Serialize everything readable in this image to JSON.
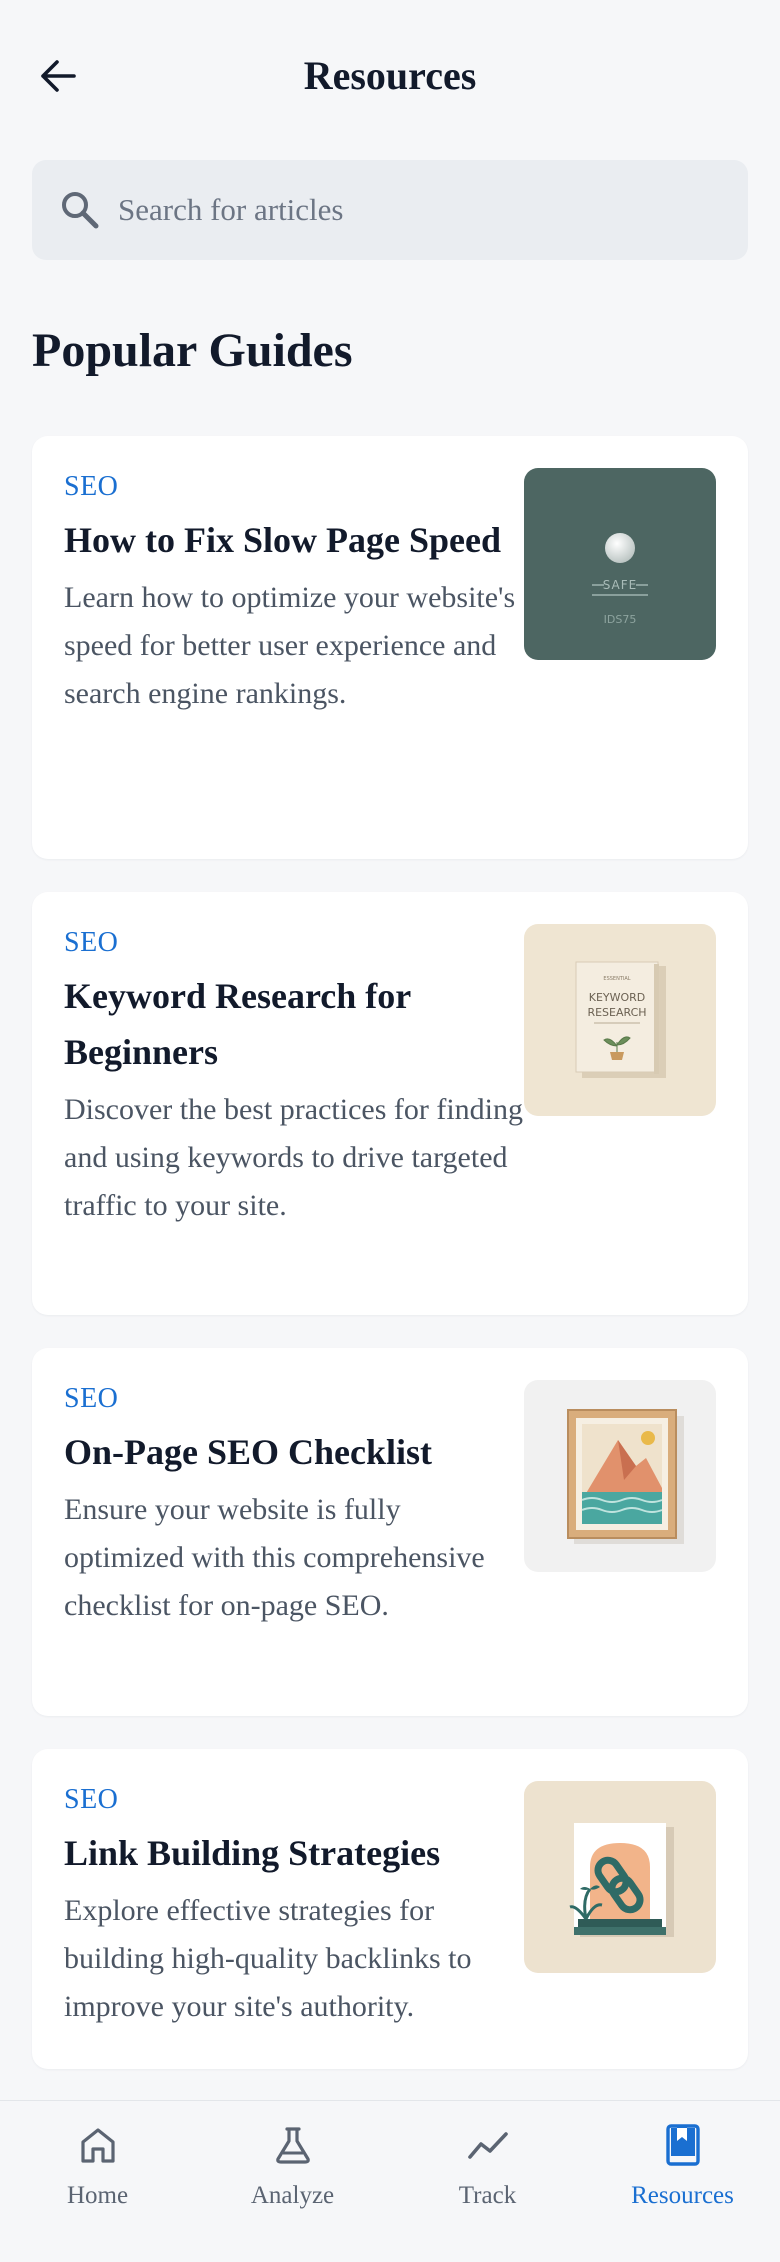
{
  "header": {
    "title": "Resources",
    "back_icon": "arrow-left-icon"
  },
  "search": {
    "placeholder": "Search for articles",
    "value": "",
    "icon": "search-icon"
  },
  "section": {
    "title": "Popular Guides"
  },
  "articles": [
    {
      "category": "SEO",
      "title": "How to Fix Slow Page Speed",
      "description": "Learn how to optimize your website's speed for better user experience and search engine rankings.",
      "thumbnail": {
        "caption_main": "SAFE",
        "caption_sub": "IDS75",
        "bg": "#4d6662"
      }
    },
    {
      "category": "SEO",
      "title": "Keyword Research for Beginners",
      "description": "Discover the best practices for finding and using keywords to drive targeted traffic to your site.",
      "thumbnail": {
        "book_kicker": "ESSENTIAL",
        "book_title_1": "KEYWORD",
        "book_title_2": "RESEARCH",
        "bg": "#efe5d2"
      }
    },
    {
      "category": "SEO",
      "title": "On-Page SEO Checklist",
      "description": "Ensure your website is fully optimized with this comprehensive checklist for on-page SEO.",
      "thumbnail": {
        "bg": "#f1f1f1"
      }
    },
    {
      "category": "SEO",
      "title": "Link Building Strategies",
      "description": "Explore effective strategies for building high-quality backlinks to improve your site's authority.",
      "thumbnail": {
        "bg": "#ede2cf"
      }
    }
  ],
  "nav": [
    {
      "label": "Home",
      "icon": "home-icon",
      "active": false
    },
    {
      "label": "Analyze",
      "icon": "flask-icon",
      "active": false
    },
    {
      "label": "Track",
      "icon": "trend-line-icon",
      "active": false
    },
    {
      "label": "Resources",
      "icon": "bookmark-book-icon",
      "active": true
    }
  ],
  "colors": {
    "accent": "#1a6fd1",
    "text": "#121a2b",
    "muted": "#4b5563",
    "background": "#f6f7f9"
  }
}
